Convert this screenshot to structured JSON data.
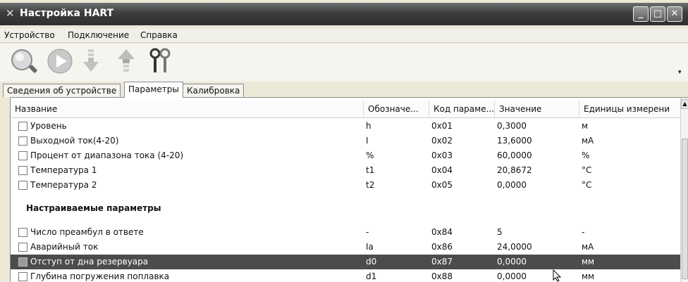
{
  "window": {
    "title": "Настройка HART",
    "icon": "hart-app-icon"
  },
  "window_controls": {
    "minimize": "_",
    "maximize": "□",
    "close": "✕"
  },
  "menu": [
    "Устройство",
    "Подключение",
    "Справка"
  ],
  "toolbar": {
    "buttons": [
      {
        "name": "search",
        "icon": "magnifier-icon"
      },
      {
        "name": "run",
        "icon": "play-icon"
      },
      {
        "name": "read",
        "icon": "arrow-down-icon"
      },
      {
        "name": "write",
        "icon": "arrow-up-icon"
      },
      {
        "name": "keys",
        "icon": "keys-icon"
      }
    ],
    "overflow_icon": "▾"
  },
  "tabs": [
    {
      "label": "Сведения об устройстве",
      "active": false
    },
    {
      "label": "Параметры",
      "active": true
    },
    {
      "label": "Калибровка",
      "active": false
    }
  ],
  "table": {
    "columns": [
      "Название",
      "Обозначе...",
      "Код параме...",
      "Значение",
      "Единицы измерени"
    ],
    "rows": [
      {
        "name": "Уровень",
        "symbol": "h",
        "code": "0x01",
        "value": "0,3000",
        "unit": "м"
      },
      {
        "name": "Выходной ток(4-20)",
        "symbol": "I",
        "code": "0x02",
        "value": "13,6000",
        "unit": "мА"
      },
      {
        "name": "Процент от диапазона тока (4-20)",
        "symbol": "%",
        "code": "0x03",
        "value": "60,0000",
        "unit": "%"
      },
      {
        "name": "Температура 1",
        "symbol": "t1",
        "code": "0x04",
        "value": "20,8672",
        "unit": "°C"
      },
      {
        "name": "Температура 2",
        "symbol": "t2",
        "code": "0x05",
        "value": "0,0000",
        "unit": "°C"
      }
    ],
    "group_label": "Настраиваемые параметры",
    "config_rows": [
      {
        "name": "Число преамбул в ответе",
        "symbol": "-",
        "code": "0x84",
        "value": "5",
        "unit": "-"
      },
      {
        "name": "Аварийный ток",
        "symbol": "Ia",
        "code": "0x86",
        "value": "24,0000",
        "unit": "мА"
      },
      {
        "name": "Отступ от дна резервуара",
        "symbol": "d0",
        "code": "0x87",
        "value": "0,0000",
        "unit": "мм",
        "selected": true
      },
      {
        "name": "Глубина погружения поплавка",
        "symbol": "d1",
        "code": "0x88",
        "value": "0,0000",
        "unit": "мм"
      }
    ]
  },
  "colors": {
    "selected_row": "#4c4c4c",
    "titlebar": "#3d3d3d"
  }
}
